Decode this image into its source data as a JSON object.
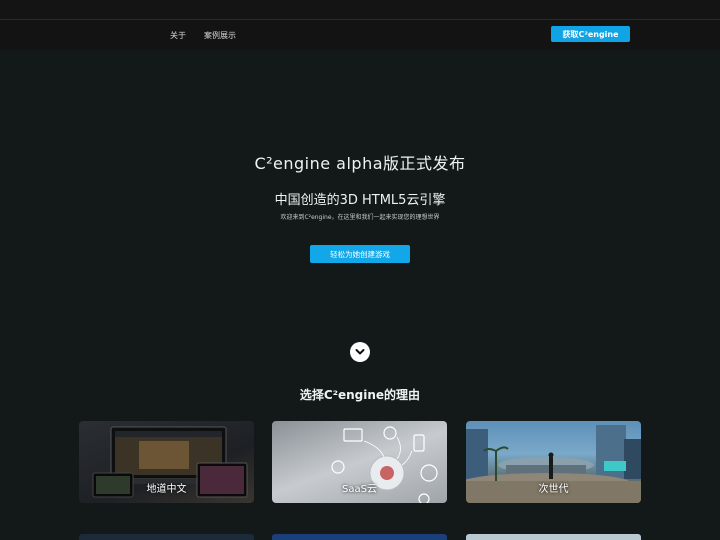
{
  "nav": {
    "about": "关于",
    "cases": "案例展示",
    "get_button": "获取C²engine"
  },
  "hero": {
    "title": "C²engine alpha版正式发布",
    "subtitle": "中国创造的3D HTML5云引擎",
    "description": "欢迎来到C²engine，在这里和我们一起来实现您的理想世界",
    "cta": "轻松为她创建游戏"
  },
  "section": {
    "title": "选择C²engine的理由"
  },
  "cards": [
    {
      "label": "地道中文"
    },
    {
      "label": "SaaS云"
    },
    {
      "label": "次世代"
    }
  ],
  "colors": {
    "accent": "#10a3e6",
    "background": "#121918",
    "navbar": "#131313"
  },
  "icons": {
    "scroll": "chevron-down-icon"
  }
}
